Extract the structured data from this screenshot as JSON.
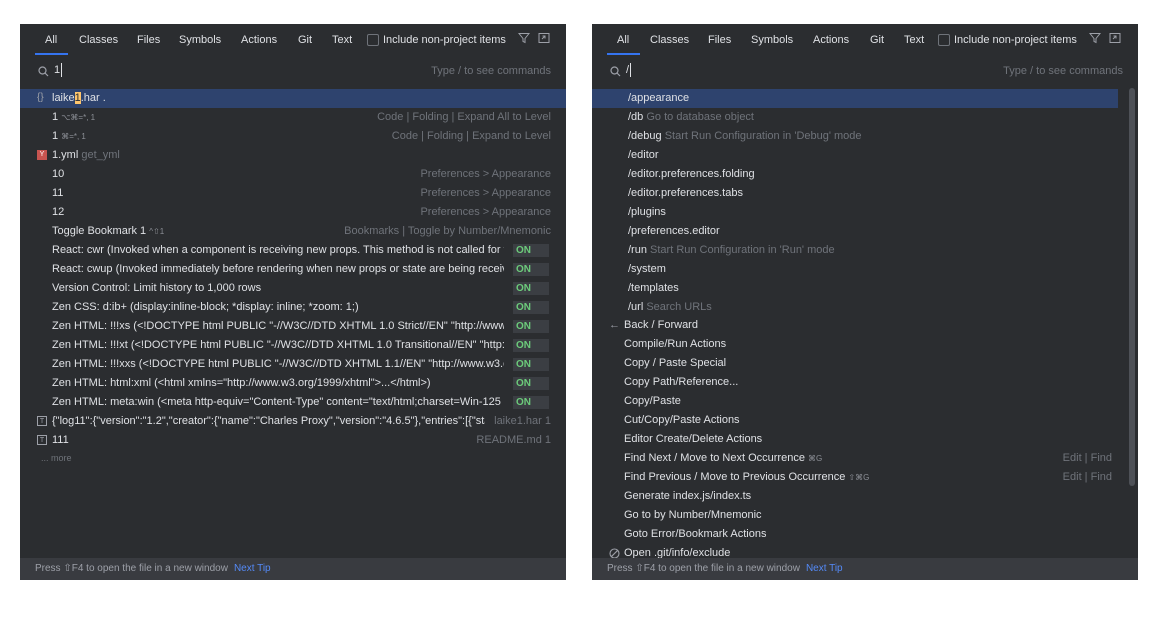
{
  "tabs": [
    "All",
    "Classes",
    "Files",
    "Symbols",
    "Actions",
    "Git",
    "Text"
  ],
  "include_non_project": "Include non-project items",
  "search_hint": "Type / to see commands",
  "footer": {
    "text": "Press ⇧F4 to open the file in a new window",
    "link": "Next Tip"
  },
  "left": {
    "query": "1",
    "rows": [
      {
        "kind": "match",
        "icon": "object-icon",
        "pre": "laike",
        "hl": "1",
        "post": ".har ."
      },
      {
        "kind": "action",
        "label": "1",
        "kbd": "⌥⌘=*, 1",
        "right": "Code | Folding | Expand All to Level"
      },
      {
        "kind": "action",
        "label": "1",
        "kbd": "⌘=*, 1",
        "right": "Code | Folding | Expand to Level"
      },
      {
        "kind": "file",
        "icon": "yml-icon",
        "label": "1.yml",
        "muted": "get_yml"
      },
      {
        "kind": "action",
        "label": "10",
        "right": "Preferences > Appearance"
      },
      {
        "kind": "action",
        "label": "11",
        "right": "Preferences > Appearance"
      },
      {
        "kind": "action",
        "label": "12",
        "right": "Preferences > Appearance"
      },
      {
        "kind": "action",
        "label": "Toggle Bookmark 1",
        "kbd": "^⇧1",
        "right": "Bookmarks | Toggle by Number/Mnemonic"
      },
      {
        "kind": "toggle",
        "label": "React: cwr (Invoked when a component is receiving new props. This method is not called for t",
        "state": "ON"
      },
      {
        "kind": "toggle",
        "label": "React: cwup (Invoked immediately before rendering when new props or state are being receiv",
        "state": "ON"
      },
      {
        "kind": "toggle",
        "label": "Version Control: Limit history to 1,000 rows",
        "state": "ON"
      },
      {
        "kind": "toggle",
        "label": "Zen CSS: d:ib+ (display:inline-block; *display: inline; *zoom: 1;)",
        "state": "ON"
      },
      {
        "kind": "toggle",
        "label": "Zen HTML: !!!xs (<!DOCTYPE html PUBLIC \"-//W3C//DTD XHTML 1.0 Strict//EN\" \"http://www.v",
        "state": "ON"
      },
      {
        "kind": "toggle",
        "label": "Zen HTML: !!!xt (<!DOCTYPE html PUBLIC \"-//W3C//DTD XHTML 1.0 Transitional//EN\" \"http://",
        "state": "ON"
      },
      {
        "kind": "toggle",
        "label": "Zen HTML: !!!xxs (<!DOCTYPE html PUBLIC \"-//W3C//DTD XHTML 1.1//EN\" \"http://www.w3.or",
        "state": "ON"
      },
      {
        "kind": "toggle",
        "label": "Zen HTML: html:xml (<html xmlns=\"http://www.w3.org/1999/xhtml\">...</html>)",
        "state": "ON"
      },
      {
        "kind": "toggle",
        "label": "Zen HTML: meta:win (<meta http-equiv=\"Content-Type\" content=\"text/html;charset=Win-125",
        "state": "ON"
      },
      {
        "kind": "text",
        "icon": "text-icon",
        "label": "{\"log11\":{\"version\":\"1.2\",\"creator\":{\"name\":\"Charles Proxy\",\"version\":\"4.6.5\"},\"entries\":[{\"sta",
        "right": "laike1.har 1"
      },
      {
        "kind": "text",
        "icon": "text-icon",
        "label": "111",
        "right": "README.md 1"
      },
      {
        "kind": "more",
        "label": "... more"
      }
    ]
  },
  "right": {
    "query": "/",
    "rows": [
      {
        "kind": "cmd",
        "label": "/appearance"
      },
      {
        "kind": "cmd",
        "label": "/db",
        "muted": "Go to database object"
      },
      {
        "kind": "cmd",
        "label": "/debug",
        "muted": "Start Run Configuration in 'Debug' mode"
      },
      {
        "kind": "cmd",
        "label": "/editor"
      },
      {
        "kind": "cmd",
        "label": "/editor.preferences.folding"
      },
      {
        "kind": "cmd",
        "label": "/editor.preferences.tabs"
      },
      {
        "kind": "cmd",
        "label": "/plugins"
      },
      {
        "kind": "cmd",
        "label": "/preferences.editor"
      },
      {
        "kind": "cmd",
        "label": "/run",
        "muted": "Start Run Configuration in 'Run' mode"
      },
      {
        "kind": "cmd",
        "label": "/system"
      },
      {
        "kind": "cmd",
        "label": "/templates"
      },
      {
        "kind": "cmd",
        "label": "/url",
        "muted": "Search URLs"
      },
      {
        "kind": "act",
        "icon": "back-arrow-icon",
        "label": "Back / Forward"
      },
      {
        "kind": "act",
        "label": "Compile/Run Actions"
      },
      {
        "kind": "act",
        "label": "Copy / Paste Special"
      },
      {
        "kind": "act",
        "label": "Copy Path/Reference..."
      },
      {
        "kind": "act",
        "label": "Copy/Paste"
      },
      {
        "kind": "act",
        "label": "Cut/Copy/Paste Actions"
      },
      {
        "kind": "act",
        "label": "Editor Create/Delete Actions"
      },
      {
        "kind": "act",
        "label": "Find Next / Move to Next Occurrence",
        "kbd": "⌘G",
        "right": "Edit | Find"
      },
      {
        "kind": "act",
        "label": "Find Previous / Move to Previous Occurrence",
        "kbd": "⇧⌘G",
        "right": "Edit | Find"
      },
      {
        "kind": "act",
        "label": "Generate index.js/index.ts"
      },
      {
        "kind": "act",
        "label": "Go to by Number/Mnemonic"
      },
      {
        "kind": "act",
        "label": "Goto Error/Bookmark Actions"
      },
      {
        "kind": "act",
        "icon": "excluded-icon",
        "label": "Open .git/info/exclude"
      }
    ]
  }
}
